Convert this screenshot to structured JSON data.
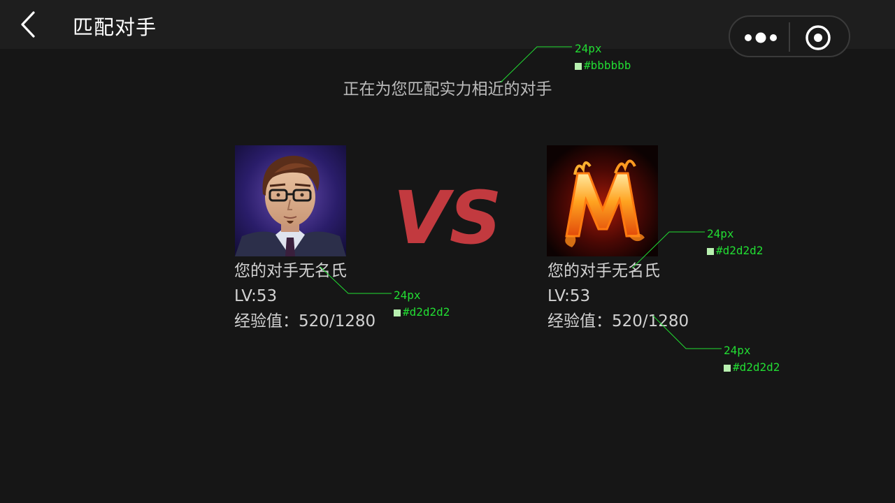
{
  "nav": {
    "title": "匹配对手"
  },
  "subtitle": "正在为您匹配实力相近的对手",
  "players": [
    {
      "name": "您的对手无名氏",
      "level": "LV:53",
      "exp": "经验值：520/1280"
    },
    {
      "name": "您的对手无名氏",
      "level": "LV:53",
      "exp": "经验值：520/1280"
    }
  ],
  "vs_label": "VS",
  "annotations": [
    {
      "size": "24px",
      "color": "#bbbbbb"
    },
    {
      "size": "24px",
      "color": "#d2d2d2"
    },
    {
      "size": "24px",
      "color": "#d2d2d2"
    },
    {
      "size": "24px",
      "color": "#d2d2d2"
    }
  ],
  "colors": {
    "background": "#161616",
    "navbar": "#1e1e1e",
    "vs": "#c23a3f",
    "annotation": "#22dd33"
  }
}
